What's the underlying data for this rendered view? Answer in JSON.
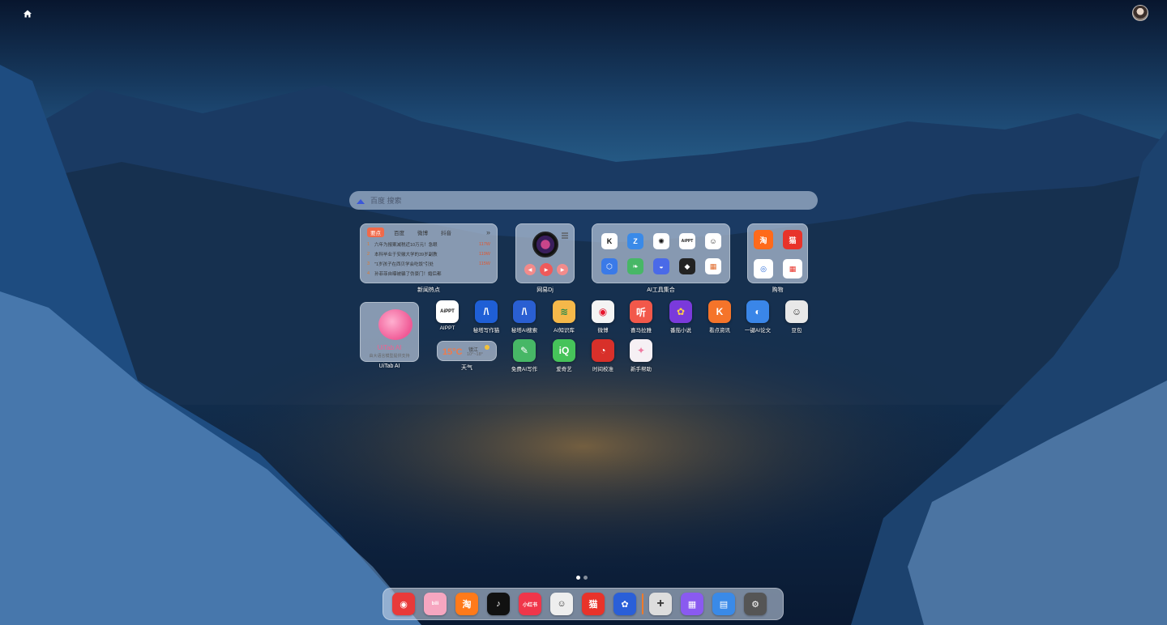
{
  "search": {
    "placeholder": "百度 搜索"
  },
  "news": {
    "caption": "新闻热点",
    "tabs": [
      "要点",
      "百度",
      "微博",
      "抖音"
    ],
    "items": [
      {
        "rank": "1",
        "title": "六年为报案减税近10万元！急眼",
        "heat": "117W"
      },
      {
        "rank": "2",
        "title": "本科毕业于安徽大学的39岁副教",
        "heat": "119W"
      },
      {
        "rank": "3",
        "title": "\"1岁孩子在西贝学会吃饭\"引处",
        "heat": "115W"
      },
      {
        "rank": "4",
        "title": "孙菲菲自曝被骗了伪豪门！婚后都",
        "heat": ""
      }
    ]
  },
  "music": {
    "caption": "网易Dj"
  },
  "ai_tools": {
    "caption": "AI工具集合"
  },
  "shopping": {
    "caption": "购物"
  },
  "uitab": {
    "caption": "UiTab AI",
    "name": "UiTab AI",
    "desc": "由大语言模型提供支持"
  },
  "weather": {
    "caption": "天气",
    "temp": "15°C",
    "city": "镇江",
    "range": "10°~18°"
  },
  "apps": [
    {
      "id": "aippt",
      "label": "AIPPT",
      "glyph": "AiPPT",
      "bg": "#ffffff",
      "fg": "#111111"
    },
    {
      "id": "mita-write",
      "label": "秘塔写作猫",
      "glyph": "/\\",
      "bg": "#1f5fd6",
      "fg": "#ffffff"
    },
    {
      "id": "mita-search",
      "label": "秘塔AI搜索",
      "glyph": "/\\",
      "bg": "#2a5fd2",
      "fg": "#ffffff"
    },
    {
      "id": "ai-knowledge",
      "label": "AI知识库",
      "glyph": "≋",
      "bg": "#f5b84a",
      "fg": "#2a8a4a"
    },
    {
      "id": "weibo",
      "label": "微博",
      "glyph": "◉",
      "bg": "#f4f4f4",
      "fg": "#e6162d"
    },
    {
      "id": "ximalaya",
      "label": "喜马拉雅",
      "glyph": "听",
      "bg": "#f2584a",
      "fg": "#ffffff"
    },
    {
      "id": "qidian",
      "label": "番茄小说",
      "glyph": "✿",
      "bg": "#7a3adb",
      "fg": "#ffd04a"
    },
    {
      "id": "news-app",
      "label": "看点资讯",
      "glyph": "K",
      "bg": "#f5742a",
      "fg": "#ffffff"
    },
    {
      "id": "ai-paper",
      "label": "一键AI论文",
      "glyph": "◐",
      "bg": "#3a86e8",
      "fg": "#ffffff"
    },
    {
      "id": "doubao",
      "label": "豆包",
      "glyph": "☺",
      "bg": "#e8e8e8",
      "fg": "#333333"
    },
    {
      "id": "free-ai-write",
      "label": "免费AI写作",
      "glyph": "✎",
      "bg": "#47b766",
      "fg": "#ffffff"
    },
    {
      "id": "iqiyi",
      "label": "爱奇艺",
      "glyph": "iQ",
      "bg": "#46c35a",
      "fg": "#ffffff"
    },
    {
      "id": "time-calib",
      "label": "时间校准",
      "glyph": "◔",
      "bg": "#d8302a",
      "fg": "#ffffff"
    },
    {
      "id": "help",
      "label": "新手帮助",
      "glyph": "✦",
      "bg": "#f6f0f4",
      "fg": "#f07aa0"
    }
  ],
  "ai_tool_icons": [
    {
      "id": "kimi",
      "glyph": "K",
      "bg": "#ffffff",
      "fg": "#111111"
    },
    {
      "id": "hunyuan",
      "glyph": "Z",
      "bg": "#3a8ae8",
      "fg": "#ffffff"
    },
    {
      "id": "chatgpt",
      "glyph": "✺",
      "bg": "#ffffff",
      "fg": "#111111"
    },
    {
      "id": "aippt-mini",
      "glyph": "AiPPT",
      "bg": "#ffffff",
      "fg": "#111111"
    },
    {
      "id": "avatar-mini",
      "glyph": "☺",
      "bg": "#ffffff",
      "fg": "#333333"
    },
    {
      "id": "hex",
      "glyph": "⬡",
      "bg": "#3a7ae8",
      "fg": "#ffffff"
    },
    {
      "id": "leaf",
      "glyph": "❧",
      "bg": "#47b766",
      "fg": "#ffffff"
    },
    {
      "id": "whale",
      "glyph": "◒",
      "bg": "#4a6ae8",
      "fg": "#ffffff"
    },
    {
      "id": "cat",
      "glyph": "◆",
      "bg": "#222222",
      "fg": "#ffffff"
    },
    {
      "id": "small-grid",
      "glyph": "▦",
      "bg": "#ffffff",
      "fg": "#e06a2a"
    }
  ],
  "shop_icons": [
    {
      "id": "taobao",
      "glyph": "淘",
      "bg": "#ff6a1a",
      "fg": "#ffffff"
    },
    {
      "id": "tmall",
      "glyph": "猫",
      "bg": "#e8332a",
      "fg": "#ffffff"
    },
    {
      "id": "jd",
      "glyph": "◎",
      "bg": "#ffffff",
      "fg": "#2a6ad8"
    },
    {
      "id": "more-shop",
      "glyph": "▦",
      "bg": "#ffffff",
      "fg": "#e8332a"
    }
  ],
  "dock": [
    {
      "id": "netease-music",
      "glyph": "◉",
      "bg": "#e83a3a",
      "fg": "#ffffff"
    },
    {
      "id": "bilibili",
      "glyph": "bili",
      "bg": "#f6a6c0",
      "fg": "#ffffff"
    },
    {
      "id": "taobao",
      "glyph": "淘",
      "bg": "#ff7a1a",
      "fg": "#ffffff"
    },
    {
      "id": "tiktok",
      "glyph": "♪",
      "bg": "#111111",
      "fg": "#ffffff"
    },
    {
      "id": "xiaohongshu",
      "glyph": "小红书",
      "bg": "#f0364a",
      "fg": "#ffffff"
    },
    {
      "id": "doubao",
      "glyph": "☺",
      "bg": "#eeeeee",
      "fg": "#333333"
    },
    {
      "id": "tmall",
      "glyph": "猫",
      "bg": "#e8332a",
      "fg": "#ffffff"
    },
    {
      "id": "baidu",
      "glyph": "✿",
      "bg": "#2a5fd8",
      "fg": "#ffffff"
    },
    {
      "id": "add",
      "glyph": "+",
      "bg": "#dddddd",
      "fg": "#333333"
    },
    {
      "id": "theme",
      "glyph": "▦",
      "bg": "#8a5af0",
      "fg": "#ffffff"
    },
    {
      "id": "wallpaper",
      "glyph": "▤",
      "bg": "#3a8ae8",
      "fg": "#ffffff"
    },
    {
      "id": "settings",
      "glyph": "⚙",
      "bg": "#555555",
      "fg": "#ffffff"
    }
  ]
}
